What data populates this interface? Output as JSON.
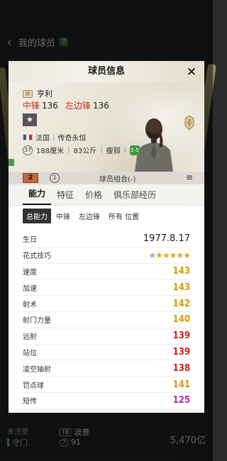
{
  "background": {
    "title": "我的球员",
    "badge": "?",
    "bottom_left": "未注册",
    "bottom_pos": "守门",
    "bottom_tag": "TB",
    "bottom_name": "波普",
    "bottom_num": "7",
    "bottom_rating": "91",
    "money": "5,470亿"
  },
  "modal": {
    "title": "球员信息",
    "close": "×"
  },
  "card": {
    "name": "亨利",
    "positions": [
      {
        "label": "中锋",
        "value": "136"
      },
      {
        "label": "左边锋",
        "value": "136"
      }
    ],
    "star_icon": "★",
    "nation": "法国",
    "season": "传奇永恒",
    "age": "37",
    "height": "188厘米",
    "weight": "83公斤",
    "build": "瘦弱",
    "foot": "5-5"
  },
  "team": {
    "enhance": "2",
    "level": "1",
    "combo_label": "球员组合(-)",
    "menu_icon": "≡"
  },
  "tabs": [
    {
      "label": "能力",
      "active": true
    },
    {
      "label": "特征",
      "active": false
    },
    {
      "label": "价格",
      "active": false
    },
    {
      "label": "俱乐部经历",
      "active": false
    }
  ],
  "subtabs": [
    {
      "label": "总能力",
      "active": true
    },
    {
      "label": "中锋",
      "active": false
    },
    {
      "label": "左边锋",
      "active": false
    },
    {
      "label": "所有 位置",
      "active": false
    }
  ],
  "birthday": {
    "label": "生日",
    "value": "1977.8.17"
  },
  "skill_moves": {
    "label": "花式技巧",
    "grey_stars": 1,
    "gold_stars": 5
  },
  "stats": [
    {
      "label": "速度",
      "value": "143",
      "color": "#d39b13"
    },
    {
      "label": "加速",
      "value": "143",
      "color": "#d39b13"
    },
    {
      "label": "射术",
      "value": "142",
      "color": "#d39b13"
    },
    {
      "label": "射门力量",
      "value": "140",
      "color": "#d39b13"
    },
    {
      "label": "远射",
      "value": "139",
      "color": "#c0261c"
    },
    {
      "label": "站位",
      "value": "139",
      "color": "#c0261c"
    },
    {
      "label": "凌空抽射",
      "value": "138",
      "color": "#c0261c"
    },
    {
      "label": "罚点球",
      "value": "141",
      "color": "#d39b13"
    },
    {
      "label": "短传",
      "value": "125",
      "color": "#b02bb8"
    }
  ]
}
